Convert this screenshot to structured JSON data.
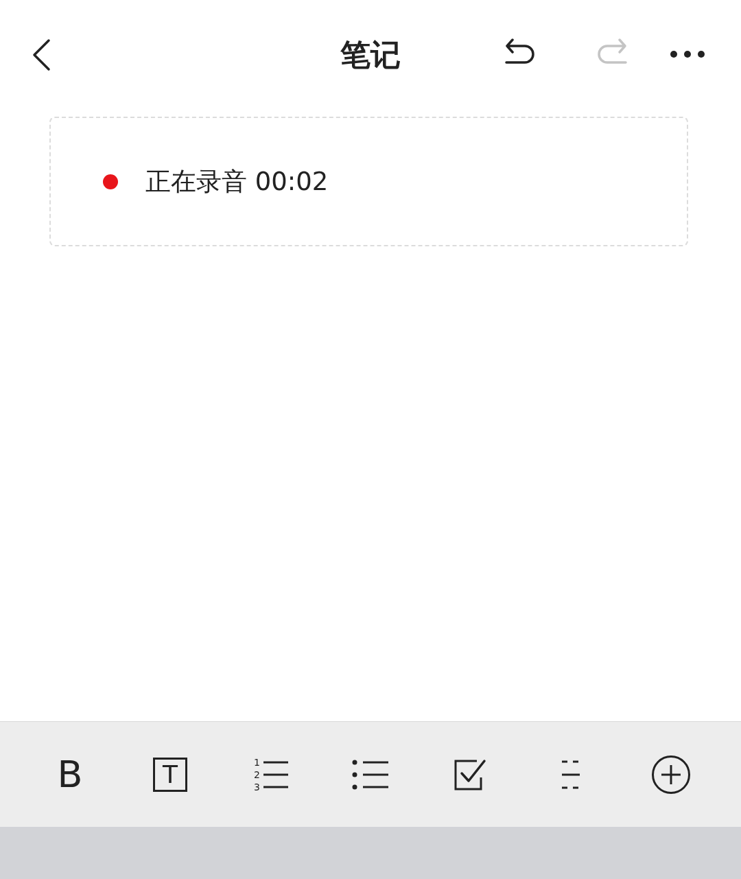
{
  "header": {
    "title": "笔记",
    "undo": {
      "disabled": false
    },
    "redo": {
      "disabled": true
    }
  },
  "recording": {
    "label": "正在录音 00:02",
    "color": "#e8151b"
  },
  "toolbar": [
    {
      "kind": "bold",
      "glyph": "B"
    },
    {
      "kind": "text",
      "glyph": "T"
    },
    {
      "kind": "numbered",
      "numbers": [
        "1",
        "2",
        "3"
      ]
    },
    {
      "kind": "bullets"
    },
    {
      "kind": "checkbox"
    },
    {
      "kind": "divider"
    },
    {
      "kind": "add"
    }
  ]
}
